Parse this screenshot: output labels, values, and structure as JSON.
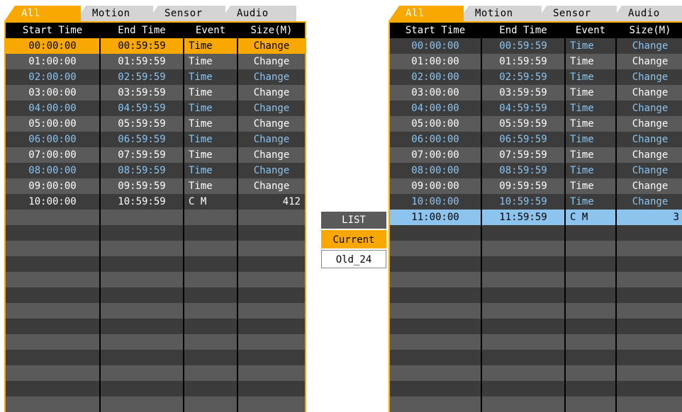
{
  "tabs": [
    "All",
    "Motion",
    "Sensor",
    "Audio"
  ],
  "columns": [
    "Start Time",
    "End Time",
    "Event",
    "Size(M)"
  ],
  "left_table": {
    "rows": [
      {
        "start": "00:00:00",
        "end": "00:59:59",
        "event": "Time",
        "size": "Change"
      },
      {
        "start": "01:00:00",
        "end": "01:59:59",
        "event": "Time",
        "size": "Change"
      },
      {
        "start": "02:00:00",
        "end": "02:59:59",
        "event": "Time",
        "size": "Change"
      },
      {
        "start": "03:00:00",
        "end": "03:59:59",
        "event": "Time",
        "size": "Change"
      },
      {
        "start": "04:00:00",
        "end": "04:59:59",
        "event": "Time",
        "size": "Change"
      },
      {
        "start": "05:00:00",
        "end": "05:59:59",
        "event": "Time",
        "size": "Change"
      },
      {
        "start": "06:00:00",
        "end": "06:59:59",
        "event": "Time",
        "size": "Change"
      },
      {
        "start": "07:00:00",
        "end": "07:59:59",
        "event": "Time",
        "size": "Change"
      },
      {
        "start": "08:00:00",
        "end": "08:59:59",
        "event": "Time",
        "size": "Change"
      },
      {
        "start": "09:00:00",
        "end": "09:59:59",
        "event": "Time",
        "size": "Change"
      },
      {
        "start": "10:00:00",
        "end": "10:59:59",
        "event": "C M",
        "size": "412"
      }
    ]
  },
  "right_table": {
    "rows": [
      {
        "start": "00:00:00",
        "end": "00:59:59",
        "event": "Time",
        "size": "Change"
      },
      {
        "start": "01:00:00",
        "end": "01:59:59",
        "event": "Time",
        "size": "Change"
      },
      {
        "start": "02:00:00",
        "end": "02:59:59",
        "event": "Time",
        "size": "Change"
      },
      {
        "start": "03:00:00",
        "end": "03:59:59",
        "event": "Time",
        "size": "Change"
      },
      {
        "start": "04:00:00",
        "end": "04:59:59",
        "event": "Time",
        "size": "Change"
      },
      {
        "start": "05:00:00",
        "end": "05:59:59",
        "event": "Time",
        "size": "Change"
      },
      {
        "start": "06:00:00",
        "end": "06:59:59",
        "event": "Time",
        "size": "Change"
      },
      {
        "start": "07:00:00",
        "end": "07:59:59",
        "event": "Time",
        "size": "Change"
      },
      {
        "start": "08:00:00",
        "end": "08:59:59",
        "event": "Time",
        "size": "Change"
      },
      {
        "start": "09:00:00",
        "end": "09:59:59",
        "event": "Time",
        "size": "Change"
      },
      {
        "start": "10:00:00",
        "end": "10:59:59",
        "event": "Time",
        "size": "Change"
      },
      {
        "start": "11:00:00",
        "end": "11:59:59",
        "event": "C M",
        "size": "3"
      }
    ]
  },
  "list_menu": {
    "title": "LIST",
    "items": [
      "Current",
      "Old_24"
    ],
    "selected": "Current"
  },
  "colors": {
    "accent": "#f8a800",
    "row_highlight_blue": "#8cc4ee",
    "row_dark": "#3c3c3c",
    "row_light": "#5a5a5a"
  }
}
